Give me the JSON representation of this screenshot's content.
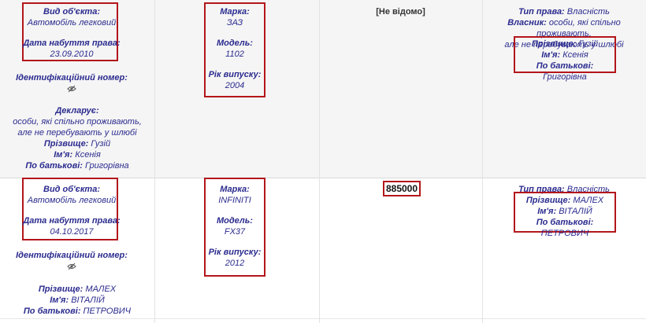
{
  "rows": [
    {
      "vehicle": {
        "type_label": "Вид об'єкта:",
        "type_value": "Автомобіль легковий",
        "date_label": "Дата набуття права:",
        "date_value": "23.09.2010",
        "id_label": "Ідентифікаційний номер:",
        "declarant_label": "Декларує:",
        "declarant_value": "особи, які спільно проживають, але не перебувають у шлюбі",
        "surname_label": "Прізвище:",
        "surname_value": "Гузій",
        "name_label": "Ім'я:",
        "name_value": "Ксенія",
        "patronymic_label": "По батькові:",
        "patronymic_value": "Григорівна"
      },
      "model": {
        "brand_label": "Марка:",
        "brand_value": "ЗАЗ",
        "model_label": "Модель:",
        "model_value": "1102",
        "year_label": "Рік випуску:",
        "year_value": "2004"
      },
      "cost": "[Не відомо]",
      "rights": {
        "type_label": "Тип права:",
        "type_value": "Власність",
        "owner_label": "Власник:",
        "owner_value_line1": "особи, які спільно проживають,",
        "owner_value_line2": "але не перебувають у шлюбі",
        "surname_label": "Прізвище:",
        "surname_value": "Гузій",
        "name_label": "Ім'я:",
        "name_value": "Ксенія",
        "patronymic_label": "По батькові:",
        "patronymic_value": "Григорівна"
      }
    },
    {
      "vehicle": {
        "type_label": "Вид об'єкта:",
        "type_value": "Автомобіль легковий",
        "date_label": "Дата набуття права:",
        "date_value": "04.10.2017",
        "id_label": "Ідентифікаційний номер:",
        "surname_label": "Прізвище:",
        "surname_value": "МАЛЕХ",
        "name_label": "Ім'я:",
        "name_value": "ВІТАЛІЙ",
        "patronymic_label": "По батькові:",
        "patronymic_value": "ПЕТРОВИЧ"
      },
      "model": {
        "brand_label": "Марка:",
        "brand_value": "INFINITI",
        "model_label": "Модель:",
        "model_value": "FX37",
        "year_label": "Рік випуску:",
        "year_value": "2012"
      },
      "cost": "885000",
      "rights": {
        "type_label": "Тип права:",
        "type_value": "Власність",
        "surname_label": "Прізвище:",
        "surname_value": "МАЛЕХ",
        "name_label": "Ім'я:",
        "name_value": "ВІТАЛІЙ",
        "patronymic_label": "По батькові:",
        "patronymic_value": "ПЕТРОВИЧ"
      }
    }
  ],
  "icons": {
    "hidden_id": "eye-crossed-icon"
  },
  "colors": {
    "highlight_border": "#b3161b",
    "label_text": "#2b2b8f"
  }
}
